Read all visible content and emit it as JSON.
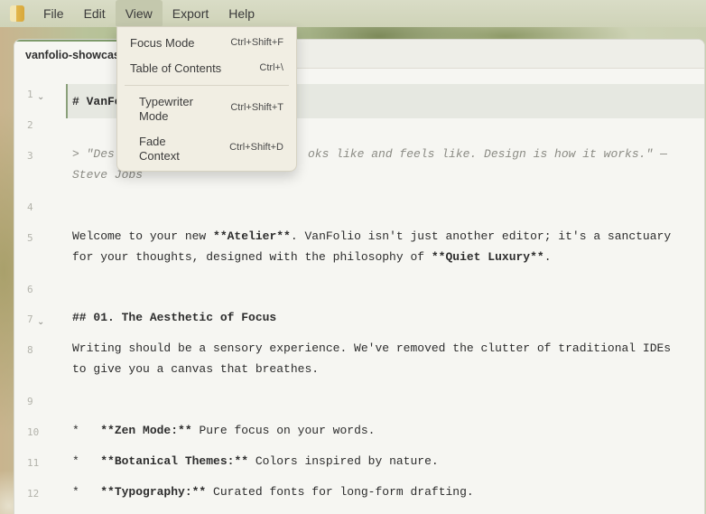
{
  "menubar": {
    "items": [
      "File",
      "Edit",
      "View",
      "Export",
      "Help"
    ],
    "active": "View"
  },
  "tab": {
    "title": "vanfolio-showcase"
  },
  "view_menu": {
    "items": [
      {
        "label": "Focus Mode",
        "shortcut": "Ctrl+Shift+F"
      },
      {
        "label": "Table of Contents",
        "shortcut": "Ctrl+\\"
      },
      {
        "label_line1": "Typewriter",
        "label_line2": "Mode",
        "shortcut": "Ctrl+Shift+T"
      },
      {
        "label_line1": "Fade",
        "label_line2": "Context",
        "shortcut": "Ctrl+Shift+D"
      }
    ]
  },
  "editor": {
    "line_numbers": [
      "1",
      "2",
      "3",
      "4",
      "5",
      "6",
      "7",
      "8",
      "9",
      "10",
      "11",
      "12"
    ],
    "line1": "# VanFo",
    "line3a": "> \"Des",
    "line3b": "oks like and feels like. Design is how it works.\" —",
    "line3c": "Steve Jobs",
    "line5a_pre": "Welcome to your new ",
    "line5a_bold": "**Atelier**",
    "line5a_post": ". VanFolio isn't just another editor; it's a sanctuary",
    "line5b_pre": "for your thoughts, designed with the philosophy of ",
    "line5b_bold": "**Quiet Luxury**",
    "line5b_post": ".",
    "line7": "## 01. The Aesthetic of Focus",
    "line8a": "Writing should be a sensory experience. We've removed the clutter of traditional IDEs",
    "line8b": "to give you a canvas that breathes.",
    "line10_bullet": "*   ",
    "line10_bold": "**Zen Mode:**",
    "line10_rest": " Pure focus on your words.",
    "line11_bullet": "*   ",
    "line11_bold": "**Botanical Themes:**",
    "line11_rest": " Colors inspired by nature.",
    "line12_bullet": "*   ",
    "line12_bold": "**Typography:**",
    "line12_rest": " Curated fonts for long-form drafting."
  },
  "colors": {
    "accent": "#7e9a6b",
    "editor_bg": "#f6f6f2",
    "menu_bg": "#f1eee3"
  },
  "icons": {
    "logo": "app-logo-icon",
    "fold": "chevron-down-icon"
  }
}
